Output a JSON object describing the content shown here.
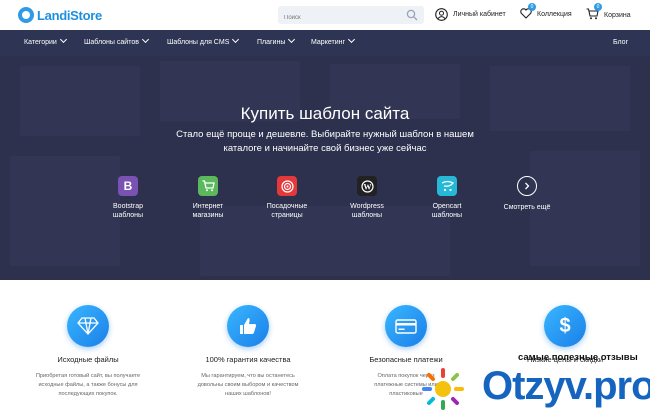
{
  "header": {
    "logo": "LandiStore",
    "search_placeholder": "Поиск",
    "account_label": "Личный кабинет",
    "collection_label": "Коллекция",
    "collection_count": "0",
    "cart_label": "Корзина",
    "cart_count": "0"
  },
  "nav": {
    "items": [
      {
        "label": "Категории"
      },
      {
        "label": "Шаблоны сайтов"
      },
      {
        "label": "Шаблоны для CMS"
      },
      {
        "label": "Плагины"
      },
      {
        "label": "Маркетинг"
      }
    ],
    "blog": "Блог"
  },
  "hero": {
    "title": "Купить шаблон сайта",
    "subtitle_line1": "Стало ещё проще и дешевле. Выбирайте нужный шаблон в нашем",
    "subtitle_line2": "каталоге и начинайте свой бизнес уже сейчас",
    "categories": [
      {
        "line1": "Bootstrap",
        "line2": "шаблоны",
        "icon": "bootstrap-icon",
        "color": "#7952b3"
      },
      {
        "line1": "Интернет",
        "line2": "магазины",
        "icon": "cart-icon",
        "color": "#5cb85c"
      },
      {
        "line1": "Посадочные",
        "line2": "страницы",
        "icon": "target-icon",
        "color": "#e5383b"
      },
      {
        "line1": "Wordpress",
        "line2": "шаблоны",
        "icon": "wordpress-icon",
        "color": "#222222"
      },
      {
        "line1": "Opencart",
        "line2": "шаблоны",
        "icon": "opencart-icon",
        "color": "#25b9d7"
      }
    ],
    "more_label": "Смотреть ещё"
  },
  "features": [
    {
      "title": "Исходные файлы",
      "desc1": "Приобретая готовый сайт, вы получаете",
      "desc2": "исходные файлы, а также бонусы для",
      "desc3": "последующих покупок.",
      "icon": "diamond-icon"
    },
    {
      "title": "100% гарантия качества",
      "desc1": "Мы гарантируем, что вы останетесь",
      "desc2": "довольны своим выбором и качеством",
      "desc3": "наших шаблонов!",
      "icon": "thumbs-up-icon"
    },
    {
      "title": "Безопасные платежи",
      "desc1": "Оплата покупок через",
      "desc2": "платежные системы или",
      "desc3": "пластиковые",
      "icon": "credit-card-icon"
    },
    {
      "title": "Низкие цены и скидки",
      "desc1": "",
      "desc2": "",
      "desc3": "",
      "icon": "dollar-icon"
    }
  ],
  "watermark": {
    "line": "самые полезные отзывы",
    "brand": "Otzyv.pro"
  },
  "colors": {
    "accent": "#2f9be6",
    "nav_bg": "#2e3453"
  }
}
